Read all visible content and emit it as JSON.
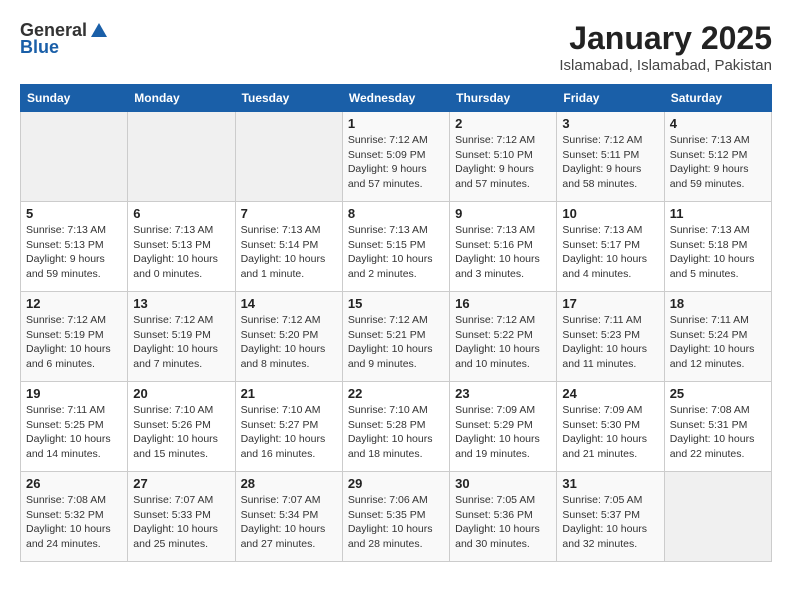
{
  "header": {
    "logo_general": "General",
    "logo_blue": "Blue",
    "title": "January 2025",
    "subtitle": "Islamabad, Islamabad, Pakistan"
  },
  "calendar": {
    "days_of_week": [
      "Sunday",
      "Monday",
      "Tuesday",
      "Wednesday",
      "Thursday",
      "Friday",
      "Saturday"
    ],
    "weeks": [
      [
        {
          "day": "",
          "detail": ""
        },
        {
          "day": "",
          "detail": ""
        },
        {
          "day": "",
          "detail": ""
        },
        {
          "day": "1",
          "detail": "Sunrise: 7:12 AM\nSunset: 5:09 PM\nDaylight: 9 hours\nand 57 minutes."
        },
        {
          "day": "2",
          "detail": "Sunrise: 7:12 AM\nSunset: 5:10 PM\nDaylight: 9 hours\nand 57 minutes."
        },
        {
          "day": "3",
          "detail": "Sunrise: 7:12 AM\nSunset: 5:11 PM\nDaylight: 9 hours\nand 58 minutes."
        },
        {
          "day": "4",
          "detail": "Sunrise: 7:13 AM\nSunset: 5:12 PM\nDaylight: 9 hours\nand 59 minutes."
        }
      ],
      [
        {
          "day": "5",
          "detail": "Sunrise: 7:13 AM\nSunset: 5:13 PM\nDaylight: 9 hours\nand 59 minutes."
        },
        {
          "day": "6",
          "detail": "Sunrise: 7:13 AM\nSunset: 5:13 PM\nDaylight: 10 hours\nand 0 minutes."
        },
        {
          "day": "7",
          "detail": "Sunrise: 7:13 AM\nSunset: 5:14 PM\nDaylight: 10 hours\nand 1 minute."
        },
        {
          "day": "8",
          "detail": "Sunrise: 7:13 AM\nSunset: 5:15 PM\nDaylight: 10 hours\nand 2 minutes."
        },
        {
          "day": "9",
          "detail": "Sunrise: 7:13 AM\nSunset: 5:16 PM\nDaylight: 10 hours\nand 3 minutes."
        },
        {
          "day": "10",
          "detail": "Sunrise: 7:13 AM\nSunset: 5:17 PM\nDaylight: 10 hours\nand 4 minutes."
        },
        {
          "day": "11",
          "detail": "Sunrise: 7:13 AM\nSunset: 5:18 PM\nDaylight: 10 hours\nand 5 minutes."
        }
      ],
      [
        {
          "day": "12",
          "detail": "Sunrise: 7:12 AM\nSunset: 5:19 PM\nDaylight: 10 hours\nand 6 minutes."
        },
        {
          "day": "13",
          "detail": "Sunrise: 7:12 AM\nSunset: 5:19 PM\nDaylight: 10 hours\nand 7 minutes."
        },
        {
          "day": "14",
          "detail": "Sunrise: 7:12 AM\nSunset: 5:20 PM\nDaylight: 10 hours\nand 8 minutes."
        },
        {
          "day": "15",
          "detail": "Sunrise: 7:12 AM\nSunset: 5:21 PM\nDaylight: 10 hours\nand 9 minutes."
        },
        {
          "day": "16",
          "detail": "Sunrise: 7:12 AM\nSunset: 5:22 PM\nDaylight: 10 hours\nand 10 minutes."
        },
        {
          "day": "17",
          "detail": "Sunrise: 7:11 AM\nSunset: 5:23 PM\nDaylight: 10 hours\nand 11 minutes."
        },
        {
          "day": "18",
          "detail": "Sunrise: 7:11 AM\nSunset: 5:24 PM\nDaylight: 10 hours\nand 12 minutes."
        }
      ],
      [
        {
          "day": "19",
          "detail": "Sunrise: 7:11 AM\nSunset: 5:25 PM\nDaylight: 10 hours\nand 14 minutes."
        },
        {
          "day": "20",
          "detail": "Sunrise: 7:10 AM\nSunset: 5:26 PM\nDaylight: 10 hours\nand 15 minutes."
        },
        {
          "day": "21",
          "detail": "Sunrise: 7:10 AM\nSunset: 5:27 PM\nDaylight: 10 hours\nand 16 minutes."
        },
        {
          "day": "22",
          "detail": "Sunrise: 7:10 AM\nSunset: 5:28 PM\nDaylight: 10 hours\nand 18 minutes."
        },
        {
          "day": "23",
          "detail": "Sunrise: 7:09 AM\nSunset: 5:29 PM\nDaylight: 10 hours\nand 19 minutes."
        },
        {
          "day": "24",
          "detail": "Sunrise: 7:09 AM\nSunset: 5:30 PM\nDaylight: 10 hours\nand 21 minutes."
        },
        {
          "day": "25",
          "detail": "Sunrise: 7:08 AM\nSunset: 5:31 PM\nDaylight: 10 hours\nand 22 minutes."
        }
      ],
      [
        {
          "day": "26",
          "detail": "Sunrise: 7:08 AM\nSunset: 5:32 PM\nDaylight: 10 hours\nand 24 minutes."
        },
        {
          "day": "27",
          "detail": "Sunrise: 7:07 AM\nSunset: 5:33 PM\nDaylight: 10 hours\nand 25 minutes."
        },
        {
          "day": "28",
          "detail": "Sunrise: 7:07 AM\nSunset: 5:34 PM\nDaylight: 10 hours\nand 27 minutes."
        },
        {
          "day": "29",
          "detail": "Sunrise: 7:06 AM\nSunset: 5:35 PM\nDaylight: 10 hours\nand 28 minutes."
        },
        {
          "day": "30",
          "detail": "Sunrise: 7:05 AM\nSunset: 5:36 PM\nDaylight: 10 hours\nand 30 minutes."
        },
        {
          "day": "31",
          "detail": "Sunrise: 7:05 AM\nSunset: 5:37 PM\nDaylight: 10 hours\nand 32 minutes."
        },
        {
          "day": "",
          "detail": ""
        }
      ]
    ]
  }
}
